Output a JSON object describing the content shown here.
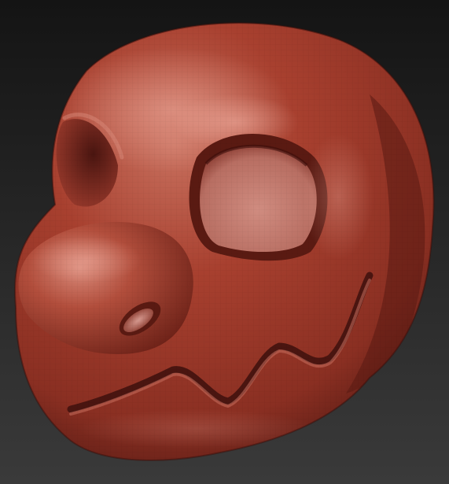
{
  "scene": {
    "subject": "sculpted-creature-head",
    "background_gradient": [
      "#141414",
      "#3a3a3a"
    ],
    "clay_colors": {
      "highlight": "#d98a7a",
      "base": "#a8402f",
      "mid": "#8a2f22",
      "shadow": "#4a1510",
      "cavity": "#c57a6c"
    }
  }
}
